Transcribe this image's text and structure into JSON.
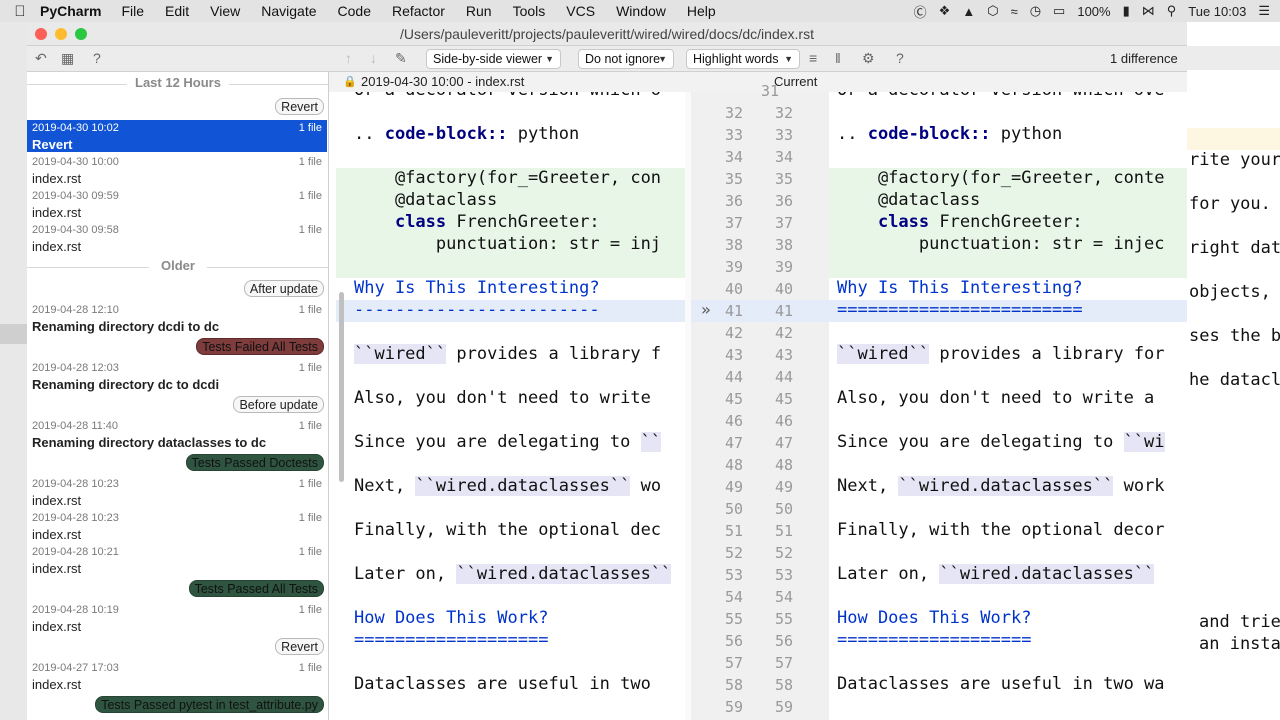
{
  "menubar": {
    "app": "PyCharm",
    "items": [
      "File",
      "Edit",
      "View",
      "Navigate",
      "Code",
      "Refactor",
      "Run",
      "Tools",
      "VCS",
      "Window",
      "Help"
    ],
    "battery": "100%",
    "clock": "Tue 10:03"
  },
  "window": {
    "title": "/Users/pauleveritt/projects/pauleveritt/wired/wired/docs/dc/index.rst"
  },
  "toolbar": {
    "viewer": "Side-by-side viewer",
    "ignore": "Do not ignore",
    "highlight": "Highlight words",
    "differences": "1 difference"
  },
  "history": {
    "groups": [
      "Last 12 Hours",
      "Older"
    ],
    "labels": {
      "revert1": "Revert",
      "after_update": "After update",
      "tests_failed": "Tests Failed All Tests",
      "before_update": "Before update",
      "tests_doctests": "Tests Passed Doctests",
      "tests_all": "Tests Passed All Tests",
      "revert2": "Revert",
      "tests_pytest": "Tests Passed pytest in test_attribute.py"
    },
    "entries": [
      {
        "date": "2019-04-30 10:02",
        "count": "1 file",
        "name": "Revert"
      },
      {
        "date": "2019-04-30 10:00",
        "count": "1 file",
        "name": "index.rst"
      },
      {
        "date": "2019-04-30 09:59",
        "count": "1 file",
        "name": "index.rst"
      },
      {
        "date": "2019-04-30 09:58",
        "count": "1 file",
        "name": "index.rst"
      },
      {
        "date": "2019-04-28 12:10",
        "count": "1 file",
        "name": "Renaming directory dcdi to dc"
      },
      {
        "date": "2019-04-28 12:03",
        "count": "1 file",
        "name": "Renaming directory dc to dcdi"
      },
      {
        "date": "2019-04-28 11:40",
        "count": "1 file",
        "name": "Renaming directory dataclasses to dc"
      },
      {
        "date": "2019-04-28 10:23",
        "count": "1 file",
        "name": "index.rst"
      },
      {
        "date": "2019-04-28 10:23",
        "count": "1 file",
        "name": "index.rst"
      },
      {
        "date": "2019-04-28 10:21",
        "count": "1 file",
        "name": "index.rst"
      },
      {
        "date": "2019-04-28 10:19",
        "count": "1 file",
        "name": "index.rst"
      },
      {
        "date": "2019-04-27 17:03",
        "count": "1 file",
        "name": "index.rst"
      }
    ]
  },
  "diff": {
    "left_title": "2019-04-30 10:00 - index.rst",
    "right_title": "Current",
    "left_line_numbers": [
      "32",
      "33",
      "34",
      "35",
      "36",
      "37",
      "38",
      "39",
      "40",
      "41",
      "42",
      "43",
      "44",
      "45",
      "46",
      "47",
      "48",
      "49",
      "50",
      "51",
      "52",
      "53",
      "54",
      "55",
      "56",
      "57",
      "58",
      "59"
    ],
    "right_line_numbers": [
      "31",
      "32",
      "33",
      "34",
      "35",
      "36",
      "37",
      "38",
      "39",
      "40",
      "41",
      "42",
      "43",
      "44",
      "45",
      "46",
      "47",
      "48",
      "49",
      "50",
      "51",
      "52",
      "53",
      "54",
      "55",
      "56",
      "57",
      "58",
      "59"
    ],
    "left_lines": {
      "l0": "Or a decorator version which o",
      "l1_kw": "code-block::",
      "l1_post": " python",
      "l2": "    @factory(for_=Greeter, con",
      "l3": "    @dataclass",
      "l4_kw": "class",
      "l4_post": " FrenchGreeter:",
      "l5": "        punctuation: str = inj",
      "h1": "Why Is This Interesting?",
      "h1u": "------------------------",
      "p1_lit": "``wired``",
      "p1_post": " provides a library f",
      "p2": "Also, you don't need to write",
      "p3_pre": "Since you are delegating to ",
      "p3_lit": "``",
      "p4_pre": "Next, ",
      "p4_lit": "``wired.dataclasses``",
      "p4_post": " wo",
      "p5": "Finally, with the optional dec",
      "p6_pre": "Later on, ",
      "p6_lit": "``wired.dataclasses``",
      "h2": "How Does This Work?",
      "h2u": "===================",
      "p7": "Dataclasses are useful in two "
    },
    "right_lines": {
      "l0": "Or a decorator version which ove",
      "l1_kw": "code-block::",
      "l1_post": " python",
      "l2": "    @factory(for_=Greeter, conte",
      "l3": "    @dataclass",
      "l4_kw": "class",
      "l4_post": " FrenchGreeter:",
      "l5": "        punctuation: str = injec",
      "h1": "Why Is This Interesting?",
      "h1u": "========================",
      "p1_lit": "``wired``",
      "p1_post": " provides a library for",
      "p2": "Also, you don't need to write a",
      "p3_pre": "Since you are delegating to ",
      "p3_lit": "``wi",
      "p4_pre": "Next, ",
      "p4_lit": "``wired.dataclasses``",
      "p4_post": " work",
      "p5": "Finally, with the optional decor",
      "p6_pre": "Later on, ",
      "p6_lit": "``wired.dataclasses``",
      "h2": "How Does This Work?",
      "h2u": "===================",
      "p7": "Dataclasses are useful in two wa"
    }
  },
  "background_editor": {
    "lines": [
      "rite your",
      "for you.",
      "right dat",
      "objects,",
      "ses the b",
      "he datacl",
      "and trie",
      "an insta"
    ]
  }
}
